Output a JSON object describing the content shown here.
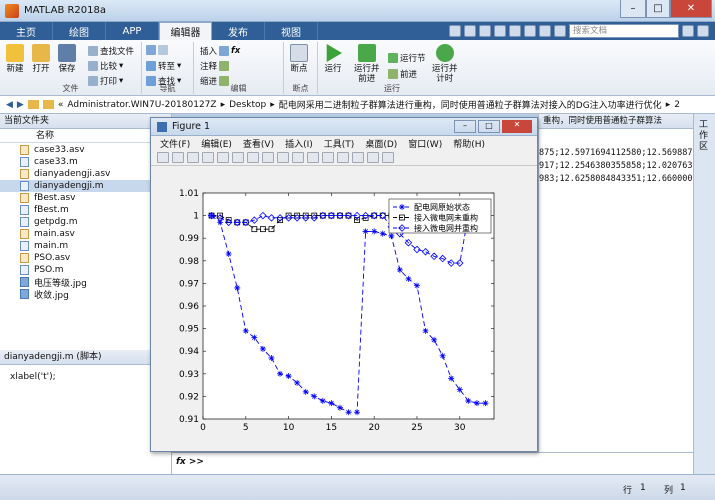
{
  "window": {
    "title": "MATLAB R2018a"
  },
  "tabs": [
    {
      "label": "主页"
    },
    {
      "label": "绘图"
    },
    {
      "label": "APP"
    },
    {
      "label": "编辑器"
    },
    {
      "label": "发布"
    },
    {
      "label": "视图"
    }
  ],
  "search": {
    "placeholder": "搜索文档"
  },
  "ribbon": {
    "file": {
      "group": "文件",
      "new": "新建",
      "open": "打开",
      "save": "保存",
      "find_files": "查找文件",
      "compare": "比较",
      "print": "打印"
    },
    "nav": {
      "group": "导航",
      "goto": "转至",
      "find": "查找"
    },
    "edit": {
      "group": "编辑",
      "insert": "插入",
      "comment": "注释",
      "indent": "缩进",
      "fx": "fx"
    },
    "breakpoints": {
      "group": "断点",
      "label": "断点"
    },
    "run": {
      "group": "运行",
      "run": "运行",
      "run_advance": "运行并\n前进",
      "run_section": "运行节",
      "advance": "前进",
      "run_time": "运行并\n计时"
    }
  },
  "address": {
    "parts": [
      "«",
      "Administrator.WIN7U-20180127Z",
      "▸",
      "Desktop",
      "▸",
      "配电网采用二进制粒子群算法进行重构，同时使用普通粒子群算法对接入的DG注入功率进行优化",
      "▸",
      "2"
    ]
  },
  "current_folder": {
    "title": "当前文件夹",
    "column": "名称",
    "files": [
      {
        "name": "case33.asv",
        "type": "doc"
      },
      {
        "name": "case33.m",
        "type": "m"
      },
      {
        "name": "dianyadengji.asv",
        "type": "doc"
      },
      {
        "name": "dianyadengji.m",
        "type": "m",
        "selected": true
      },
      {
        "name": "fBest.asv",
        "type": "doc"
      },
      {
        "name": "fBest.m",
        "type": "m"
      },
      {
        "name": "getpdg.m",
        "type": "m"
      },
      {
        "name": "main.asv",
        "type": "doc"
      },
      {
        "name": "main.m",
        "type": "m"
      },
      {
        "name": "PSO.asv",
        "type": "doc"
      },
      {
        "name": "PSO.m",
        "type": "m"
      },
      {
        "name": "电压等级.jpg",
        "type": "img"
      },
      {
        "name": "收敛.jpg",
        "type": "img"
      }
    ],
    "details_title": "dianyadengji.m  (脚本)",
    "details_text": "xlabel('t');"
  },
  "figure": {
    "title": "Figure 1",
    "menu": [
      "文件(F)",
      "编辑(E)",
      "查看(V)",
      "插入(I)",
      "工具(T)",
      "桌面(D)",
      "窗口(W)",
      "帮助(H)"
    ]
  },
  "right_pane": {
    "header": "重构，同时使用普通粒子群算法",
    "lines": [
      "875;12.5971694112580;12.569887",
      "917;12.2546380355858;12.020763",
      "983;12.6258084843351;12.660000"
    ],
    "side_label": "工作区"
  },
  "command": {
    "prompt": "fx >>"
  },
  "status": {
    "row_label": "行",
    "row": "1",
    "col_label": "列",
    "col": "1"
  },
  "chart_data": {
    "type": "line",
    "xlim": [
      0,
      34
    ],
    "ylim": [
      0.91,
      1.01
    ],
    "xticks": [
      0,
      5,
      10,
      15,
      20,
      25,
      30
    ],
    "yticks": [
      0.91,
      0.92,
      0.93,
      0.94,
      0.95,
      0.96,
      0.97,
      0.98,
      0.99,
      1,
      1.01
    ],
    "grid": false,
    "legend_position": "top-right",
    "x": [
      1,
      2,
      3,
      4,
      5,
      6,
      7,
      8,
      9,
      10,
      11,
      12,
      13,
      14,
      15,
      16,
      17,
      18,
      19,
      20,
      21,
      22,
      23,
      24,
      25,
      26,
      27,
      28,
      29,
      30,
      31,
      32,
      33
    ],
    "series": [
      {
        "name": "配电网原始状态",
        "marker": "star",
        "color": "#0000ff",
        "values": [
          1.0,
          0.997,
          0.983,
          0.968,
          0.949,
          0.946,
          0.941,
          0.937,
          0.93,
          0.929,
          0.926,
          0.922,
          0.92,
          0.918,
          0.917,
          0.915,
          0.913,
          0.913,
          0.993,
          0.993,
          0.992,
          0.991,
          0.976,
          0.972,
          0.969,
          0.949,
          0.945,
          0.938,
          0.928,
          0.923,
          0.918,
          0.917,
          0.917
        ]
      },
      {
        "name": "接入微电网未重构",
        "marker": "square",
        "color": "#000000",
        "values": [
          1.0,
          1.0,
          0.998,
          0.997,
          0.997,
          0.994,
          0.994,
          0.994,
          0.998,
          1.0,
          1.0,
          1.0,
          1.0,
          1.0,
          1.0,
          1.0,
          1.0,
          0.998,
          0.999,
          1.0,
          1.0,
          1.0,
          1.0,
          0.999,
          0.999,
          1.0,
          1.0,
          1.0,
          1.0,
          1.0,
          1.0,
          1.0,
          1.0
        ]
      },
      {
        "name": "接入微电网并重构",
        "marker": "diamond",
        "color": "#0000ff",
        "values": [
          1.0,
          0.999,
          0.997,
          0.997,
          0.997,
          0.998,
          1.0,
          0.999,
          0.999,
          0.999,
          0.999,
          0.999,
          0.999,
          1.0,
          1.0,
          1.0,
          1.0,
          1.0,
          1.0,
          1.0,
          1.0,
          0.995,
          0.992,
          0.988,
          0.985,
          0.984,
          0.982,
          0.981,
          0.979,
          0.979,
          1.0,
          1.0,
          1.0
        ]
      }
    ]
  }
}
